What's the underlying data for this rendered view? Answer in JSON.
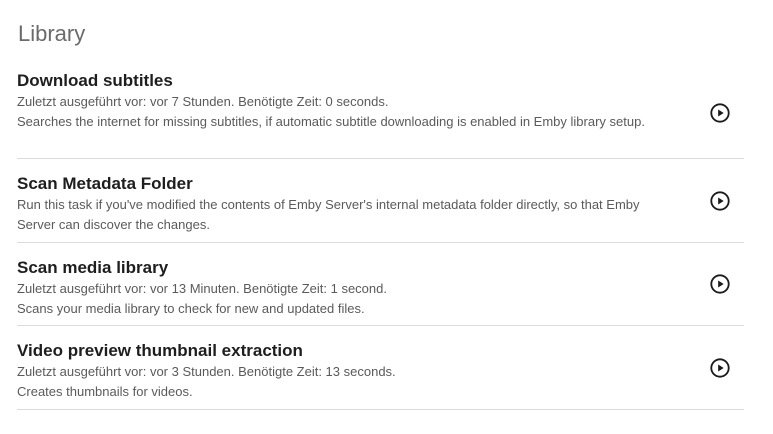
{
  "section": {
    "title": "Library"
  },
  "tasks": [
    {
      "name": "Download subtitles",
      "last_run": "Zuletzt ausgeführt vor: vor 7 Stunden. Benötigte Zeit: 0 seconds.",
      "description": "Searches the internet for missing subtitles, if automatic subtitle downloading is enabled in Emby library setup.",
      "action_icon": "play-circle-icon"
    },
    {
      "name": "Scan Metadata Folder",
      "last_run": "",
      "description": "Run this task if you've modified the contents of Emby Server's internal metadata folder directly, so that Emby Server can discover the changes.",
      "action_icon": "play-circle-icon"
    },
    {
      "name": "Scan media library",
      "last_run": "Zuletzt ausgeführt vor: vor 13 Minuten. Benötigte Zeit: 1 second.",
      "description": "Scans your media library to check for new and updated files.",
      "action_icon": "play-circle-icon"
    },
    {
      "name": "Video preview thumbnail extraction",
      "last_run": "Zuletzt ausgeführt vor: vor 3 Stunden. Benötigte Zeit: 13 seconds.",
      "description": "Creates thumbnails for videos.",
      "action_icon": "play-circle-icon"
    }
  ]
}
